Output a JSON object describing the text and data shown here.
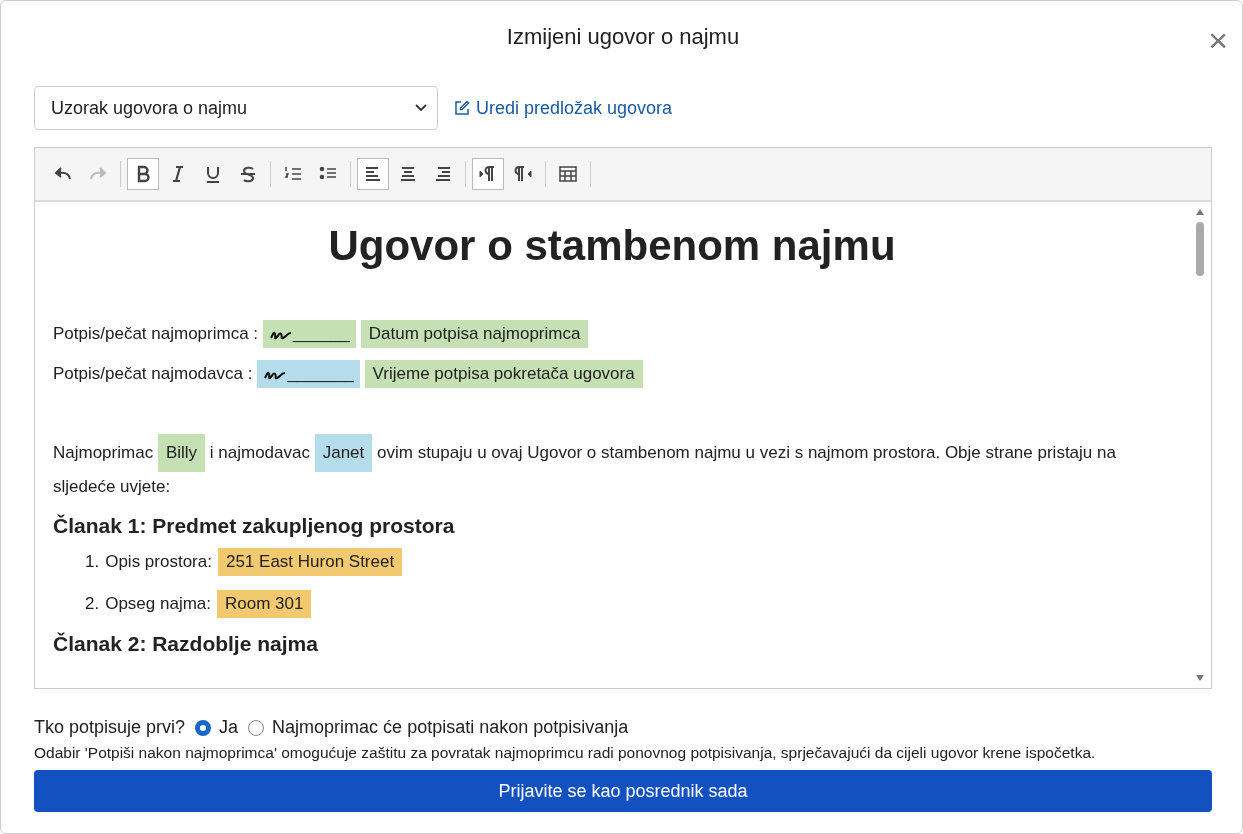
{
  "dialog": {
    "title": "Izmijeni ugovor o najmu",
    "close": "×"
  },
  "template_select": {
    "value": "Uzorak ugovora o najmu"
  },
  "edit_template_link": "Uredi predložak ugovora",
  "toolbar": [
    {
      "kind": "undo",
      "active": false,
      "disabled": false
    },
    {
      "kind": "redo",
      "active": false,
      "disabled": true
    },
    {
      "kind": "sep"
    },
    {
      "kind": "bold",
      "active": true,
      "disabled": false
    },
    {
      "kind": "italic",
      "active": false,
      "disabled": false
    },
    {
      "kind": "underline",
      "active": false,
      "disabled": false
    },
    {
      "kind": "strike",
      "active": false,
      "disabled": false
    },
    {
      "kind": "sep"
    },
    {
      "kind": "ol",
      "active": false,
      "disabled": false
    },
    {
      "kind": "ul",
      "active": false,
      "disabled": false
    },
    {
      "kind": "sep"
    },
    {
      "kind": "left",
      "active": true,
      "disabled": false
    },
    {
      "kind": "center",
      "active": false,
      "disabled": false
    },
    {
      "kind": "right",
      "active": false,
      "disabled": false
    },
    {
      "kind": "sep"
    },
    {
      "kind": "ltr",
      "active": true,
      "disabled": false
    },
    {
      "kind": "rtl",
      "active": false,
      "disabled": false
    },
    {
      "kind": "sep"
    },
    {
      "kind": "table",
      "active": false,
      "disabled": false
    },
    {
      "kind": "sep"
    }
  ],
  "document": {
    "title": "Ugovor o stambenom najmu",
    "signature_lines": [
      {
        "label": "Potpis/pečat najmoprimca :",
        "signature": {
          "line": "______",
          "color": "#c5e0b3"
        },
        "field": {
          "text": "Datum potpisa najmoprimca",
          "color": "#c5e0b3"
        }
      },
      {
        "label": "Potpis/pečat najmodavca :",
        "signature": {
          "line": "_______",
          "color": "#b4dcea"
        },
        "field": {
          "text": "Vrijeme potpisa pokretača ugovora",
          "color": "#c5e0b3"
        }
      }
    ],
    "intro": [
      {
        "text": "Najmoprimac"
      },
      {
        "text": "Billy",
        "color": "#c5e0b3"
      },
      {
        "text": "i najmodavac"
      },
      {
        "text": "Janet",
        "color": "#b4dcea"
      },
      {
        "text": "ovim stupaju u ovaj Ugovor o stambenom najmu u vezi s najmom prostora. Obje strane pristaju na sljedeće uvjete:"
      }
    ],
    "sections": [
      {
        "heading": "Članak 1: Predmet zakupljenog prostora",
        "items": [
          {
            "number": "1.",
            "label": "Opis prostora:",
            "value": "251 East Huron Street",
            "color": "#f2c96e"
          },
          {
            "number": "2.",
            "label": "Opseg najma:",
            "value": "Room 301",
            "color": "#f2c96e"
          }
        ]
      },
      {
        "heading": "Članak 2: Razdoblje najma"
      }
    ]
  },
  "signing_order": {
    "label": "Tko potpisuje prvi?",
    "options": [
      {
        "label": "Ja",
        "selected": true
      },
      {
        "label": "Najmoprimac će potpisati nakon potpisivanja",
        "selected": false
      }
    ],
    "note": "Odabir 'Potpiši nakon najmoprimca' omogućuje zaštitu za povratak najmoprimcu radi ponovnog potpisivanja, sprječavajući da cijeli ugovor krene ispočetka."
  },
  "submit_button": "Prijavite se kao posrednik sada"
}
